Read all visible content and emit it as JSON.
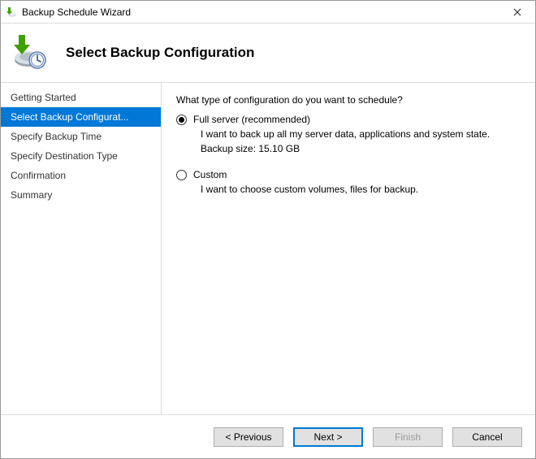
{
  "window": {
    "title": "Backup Schedule Wizard"
  },
  "header": {
    "heading": "Select Backup Configuration"
  },
  "sidebar": {
    "items": [
      {
        "label": "Getting Started"
      },
      {
        "label": "Select Backup Configurat..."
      },
      {
        "label": "Specify Backup Time"
      },
      {
        "label": "Specify Destination Type"
      },
      {
        "label": "Confirmation"
      },
      {
        "label": "Summary"
      }
    ]
  },
  "content": {
    "prompt": "What type of configuration do you want to schedule?",
    "options": {
      "full": {
        "label": "Full server (recommended)",
        "description": "I want to back up all my server data, applications and system state.",
        "size_line": "Backup size: 15.10 GB"
      },
      "custom": {
        "label": "Custom",
        "description": "I want to choose custom volumes, files for backup."
      }
    }
  },
  "footer": {
    "previous": "< Previous",
    "next": "Next >",
    "finish": "Finish",
    "cancel": "Cancel"
  }
}
